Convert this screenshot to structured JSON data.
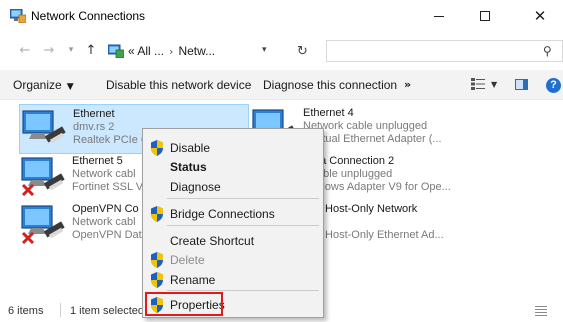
{
  "window": {
    "title": "Network Connections",
    "icon": "network-connections-icon"
  },
  "address_bar": {
    "breadcrumbs": [
      "« All ...",
      "Netw..."
    ],
    "separator": "›",
    "search_placeholder": ""
  },
  "command_bar": {
    "organize": "Organize",
    "disable": "Disable this network device",
    "diagnose": "Diagnose this connection",
    "more": "»"
  },
  "items": [
    {
      "name": "Ethernet",
      "line1": "dmv.rs 2",
      "line2": "Realtek PCIe C",
      "status": "connected",
      "selected": true
    },
    {
      "name": "Ethernet 4",
      "line1": "Network cable unplugged",
      "line2": "t Virtual Ethernet Adapter (...",
      "status": "connected",
      "selected": false
    },
    {
      "name": "Ethernet 5",
      "line1": "Network cabl",
      "line2": "Fortinet SSL V",
      "status": "disconnected",
      "selected": false
    },
    {
      "name": "Area Connection 2",
      "line1": "k cable unplugged",
      "line2": "Vindows Adapter V9 for Ope...",
      "status": "connected",
      "selected": false
    },
    {
      "name": "OpenVPN Co",
      "line1": "Network cabl",
      "line2": "OpenVPN Dat",
      "status": "disconnected",
      "selected": false
    },
    {
      "name": "Box Host-Only Network",
      "line1": "ed",
      "line2": "Box Host-Only Ethernet Ad...",
      "status": "connected",
      "selected": false
    }
  ],
  "status_bar": {
    "count": "6 items",
    "selected": "1 item selected"
  },
  "context_menu": {
    "items": [
      {
        "label": "Disable",
        "shield": true,
        "bold": false,
        "disabled": false
      },
      {
        "label": "Status",
        "shield": false,
        "bold": true,
        "disabled": false
      },
      {
        "label": "Diagnose",
        "shield": false,
        "bold": false,
        "disabled": false
      },
      {
        "label": "Bridge Connections",
        "shield": true,
        "bold": false,
        "disabled": false
      },
      {
        "label": "Create Shortcut",
        "shield": false,
        "bold": false,
        "disabled": false
      },
      {
        "label": "Delete",
        "shield": true,
        "bold": false,
        "disabled": true
      },
      {
        "label": "Rename",
        "shield": true,
        "bold": false,
        "disabled": false
      },
      {
        "label": "Properties",
        "shield": true,
        "bold": false,
        "disabled": false
      }
    ],
    "highlighted": "Properties"
  },
  "colors": {
    "selection_bg": "#cce8ff",
    "selection_border": "#99d1ff",
    "highlight_box": "#e01b1b",
    "shield_blue": "#1f5fc0",
    "shield_yellow": "#f2c500",
    "error_red": "#d32020"
  }
}
